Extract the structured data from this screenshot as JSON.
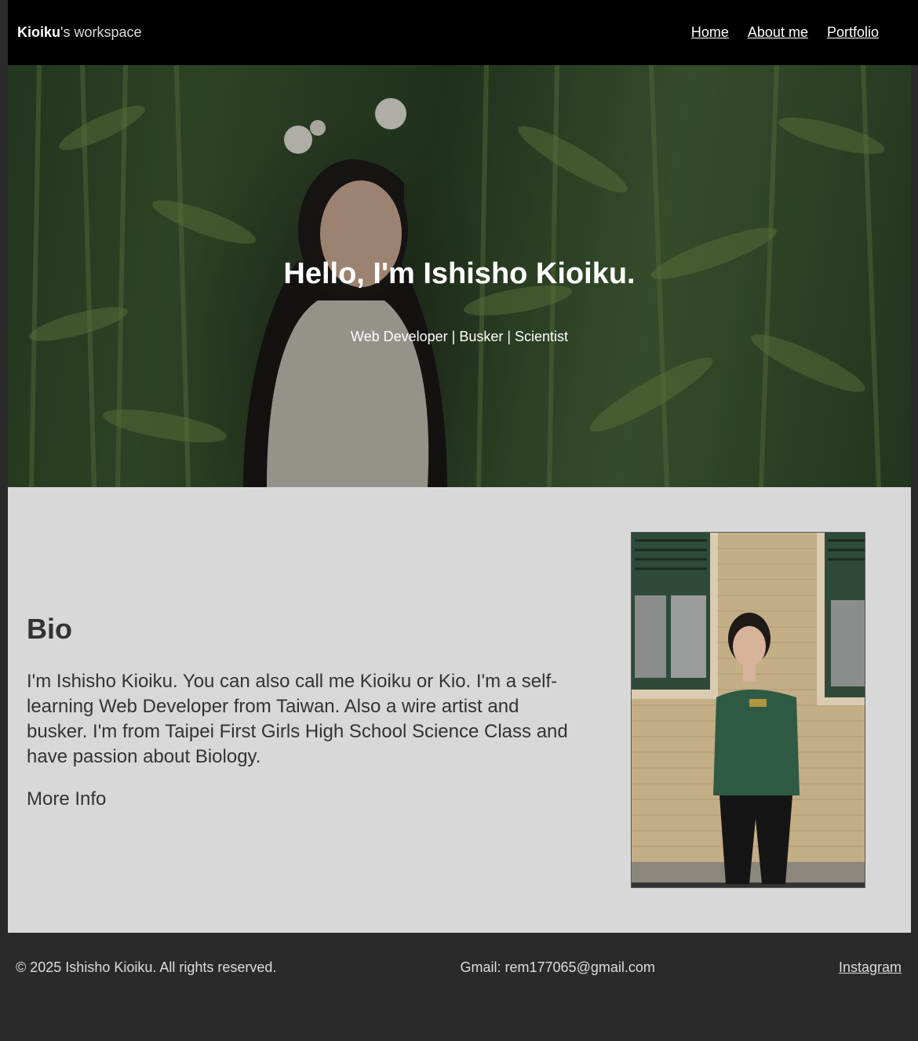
{
  "nav": {
    "brand_name": "Kioiku",
    "brand_suffix": "'s workspace",
    "links": [
      "Home",
      "About me",
      "Portfolio"
    ]
  },
  "hero": {
    "title": "Hello, I'm Ishisho Kioiku.",
    "subtitle": "Web Developer | Busker | Scientist"
  },
  "bio": {
    "heading": "Bio",
    "text": "I'm Ishisho Kioiku. You can also call me Kioiku or Kio. I'm a self-learning Web Developer from Taiwan. Also a wire artist and busker. I'm from Taipei First Girls High School Science Class and have passion about Biology.",
    "more_label": "More Info"
  },
  "footer": {
    "copyright": "© 2025 Ishisho Kioiku. All rights reserved.",
    "email": "Gmail: rem177065@gmail.com",
    "instagram_label": "Instagram"
  }
}
